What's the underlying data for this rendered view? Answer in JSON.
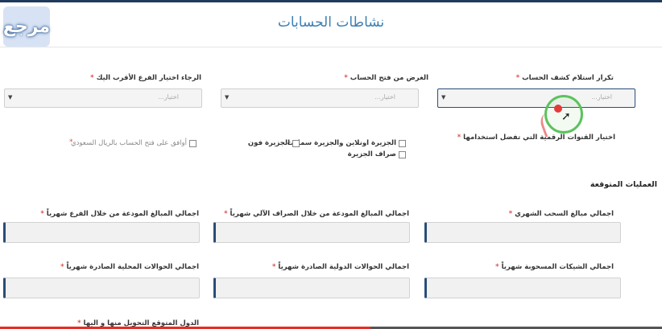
{
  "logo": {
    "text": "مرجع"
  },
  "page_title": "نشاطات الحسابات",
  "row1": {
    "statement_frequency": {
      "label": "تكرار استلام كشف الحساب",
      "required": "*",
      "placeholder": "اختيار..."
    },
    "account_purpose": {
      "label": "الغرض من فتح الحساب",
      "required": "*",
      "placeholder": "اختيار..."
    },
    "branch": {
      "label": "الرجاء اختيار الفرع الأقرب اليك",
      "required": "*",
      "placeholder": "اختيار..."
    }
  },
  "digital_channels": {
    "label": "اختيار القنوات الرقمية التي تفضل استخدامها",
    "required": "*",
    "options": [
      "الجزيرة اونلاين والجزيرة سمارت",
      "الجزيرة فون",
      "صراف الجزيرة"
    ]
  },
  "consent": {
    "label": "أوافق على فتح الحساب بالريال السعودي",
    "required": "*"
  },
  "expected_ops": {
    "title": "العمليات المتوقعة",
    "fields": [
      {
        "label": "اجمالي مبالغ السحب الشهري",
        "required": "*"
      },
      {
        "label": "اجمالي المبالغ المودعة من خلال الصراف الآلي شهرياً",
        "required": "*"
      },
      {
        "label": "اجمالي المبالغ المودعة من خلال الفرع شهرياً",
        "required": "*"
      },
      {
        "label": "اجمالي الشيكات المسحوبة شهرياً",
        "required": "*"
      },
      {
        "label": "اجمالي الحوالات الدولية الصادرة شهرياً",
        "required": "*"
      },
      {
        "label": "اجمالي الحوالات المحلية الصادرة شهرياً",
        "required": "*"
      },
      {
        "label": "الدول المتوقع التحويل منها و اليها",
        "required": "*"
      }
    ]
  },
  "video": {
    "progress": 0.56
  },
  "colors": {
    "accent": "#2a4d78",
    "title": "#3d7fb3",
    "required": "#d9534f",
    "cursor_ring": "#5cc25c"
  }
}
